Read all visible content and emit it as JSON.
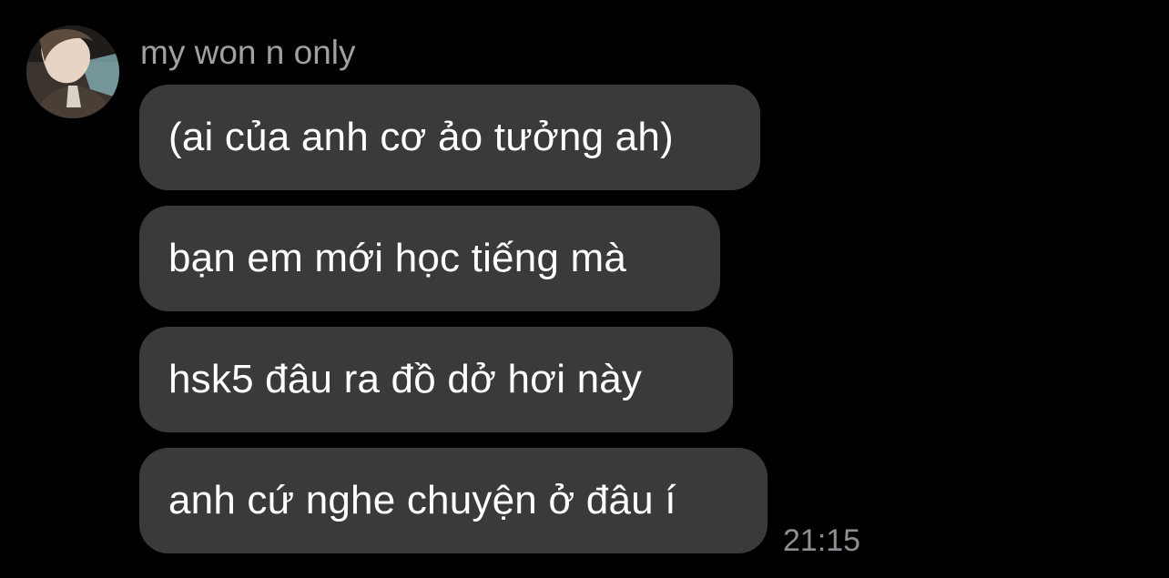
{
  "conversation": {
    "sender_name": "my won n only",
    "avatar_icon": "profile-photo",
    "messages": [
      {
        "text": "(ai của anh cơ ảo tưởng ah)"
      },
      {
        "text": "bạn em mới học tiếng mà"
      },
      {
        "text": "hsk5 đâu ra đồ dở hơi này"
      },
      {
        "text": "anh cứ nghe chuyện ở đâu í"
      }
    ],
    "timestamp": "21:15"
  },
  "colors": {
    "background": "#000000",
    "bubble": "#3a3a3c",
    "message_text": "#ffffff",
    "sender_text": "#a0a0a4",
    "timestamp_text": "#8e8e93"
  }
}
